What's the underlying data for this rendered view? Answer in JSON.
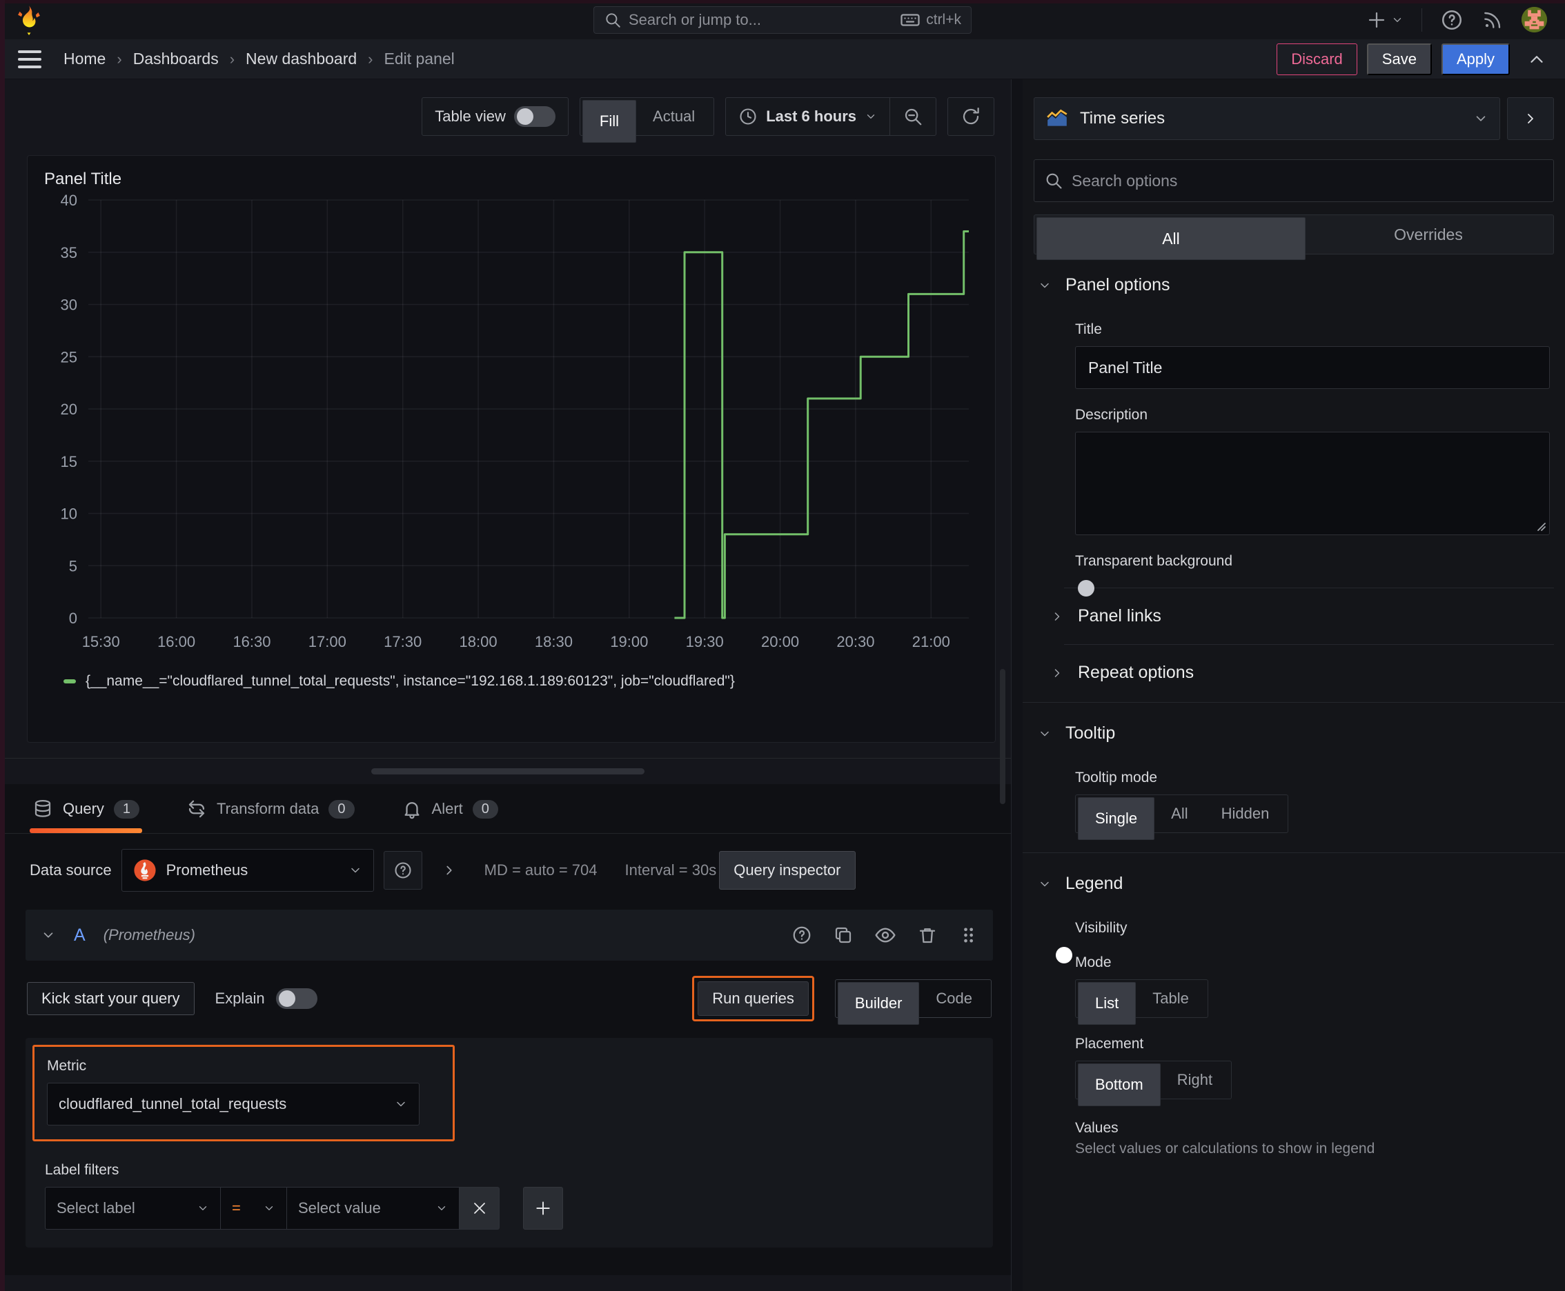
{
  "topnav": {
    "search_placeholder": "Search or jump to...",
    "search_shortcut": "ctrl+k"
  },
  "breadcrumb": {
    "items": [
      "Home",
      "Dashboards",
      "New dashboard",
      "Edit panel"
    ],
    "discard_label": "Discard",
    "save_label": "Save",
    "apply_label": "Apply"
  },
  "viz_toolbar": {
    "table_view_label": "Table view",
    "fill_label": "Fill",
    "actual_label": "Actual",
    "time_range_label": "Last 6 hours"
  },
  "panel": {
    "title": "Panel Title",
    "legend_series": "{__name__=\"cloudflared_tunnel_total_requests\", instance=\"192.168.1.189:60123\", job=\"cloudflared\"}"
  },
  "chart_data": {
    "type": "line",
    "line_style": "step-after",
    "title": "Panel Title",
    "series_name": "{__name__=\"cloudflared_tunnel_total_requests\", instance=\"192.168.1.189:60123\", job=\"cloudflared\"}",
    "color": "#73bf69",
    "grid": true,
    "legend_position": "bottom",
    "x_unit": "minutes after 15:00",
    "x_range": [
      25,
      375
    ],
    "y_range": [
      0,
      40
    ],
    "y_ticks": [
      0,
      5,
      10,
      15,
      20,
      25,
      30,
      35,
      40
    ],
    "x_tick_minutes": [
      30,
      60,
      90,
      120,
      150,
      180,
      210,
      240,
      270,
      300,
      330,
      360
    ],
    "x_tick_labels": [
      "15:30",
      "16:00",
      "16:30",
      "17:00",
      "17:30",
      "18:00",
      "18:30",
      "19:00",
      "19:30",
      "20:00",
      "20:30",
      "21:00"
    ],
    "points": [
      [
        258,
        0
      ],
      [
        262,
        35
      ],
      [
        276,
        35
      ],
      [
        277,
        0
      ],
      [
        278,
        8
      ],
      [
        310,
        8
      ],
      [
        311,
        21
      ],
      [
        331,
        21
      ],
      [
        332,
        25
      ],
      [
        350,
        25
      ],
      [
        351,
        31
      ],
      [
        372,
        31
      ],
      [
        373,
        37
      ],
      [
        375,
        37
      ]
    ]
  },
  "tabs": {
    "query_label": "Query",
    "query_count": "1",
    "transform_label": "Transform data",
    "transform_count": "0",
    "alert_label": "Alert",
    "alert_count": "0"
  },
  "datasource_row": {
    "label": "Data source",
    "value": "Prometheus",
    "stats_md": "MD = auto = 704",
    "stats_interval": "Interval = 30s",
    "inspector_label": "Query inspector"
  },
  "query_editor": {
    "ref_id": "A",
    "ds_hint": "(Prometheus)",
    "kick_start_label": "Kick start your query",
    "explain_label": "Explain",
    "run_queries_label": "Run queries",
    "builder_label": "Builder",
    "code_label": "Code",
    "metric_label": "Metric",
    "metric_value": "cloudflared_tunnel_total_requests",
    "label_filters_label": "Label filters",
    "select_label_placeholder": "Select label",
    "operator": "=",
    "select_value_placeholder": "Select value"
  },
  "sidebar": {
    "viz_type": "Time series",
    "search_placeholder": "Search options",
    "tab_all": "All",
    "tab_overrides": "Overrides",
    "panel_options": {
      "heading": "Panel options",
      "title_label": "Title",
      "title_value": "Panel Title",
      "description_label": "Description",
      "transparent_label": "Transparent background"
    },
    "links_heading": "Panel links",
    "repeat_heading": "Repeat options",
    "tooltip": {
      "heading": "Tooltip",
      "mode_label": "Tooltip mode",
      "options": [
        "Single",
        "All",
        "Hidden"
      ],
      "selected": "Single"
    },
    "legend": {
      "heading": "Legend",
      "visibility_label": "Visibility",
      "mode_label": "Mode",
      "mode_options": [
        "List",
        "Table"
      ],
      "placement_label": "Placement",
      "placement_options": [
        "Bottom",
        "Right"
      ],
      "values_label": "Values",
      "values_help": "Select values or calculations to show in legend"
    }
  },
  "colors": {
    "series_green": "#73bf69",
    "highlight_orange": "#e5631e",
    "accent_blue": "#3d71d9",
    "danger_pink": "#e0457b",
    "tab_underline_gradient": [
      "#f2562a",
      "#ff8833"
    ]
  }
}
